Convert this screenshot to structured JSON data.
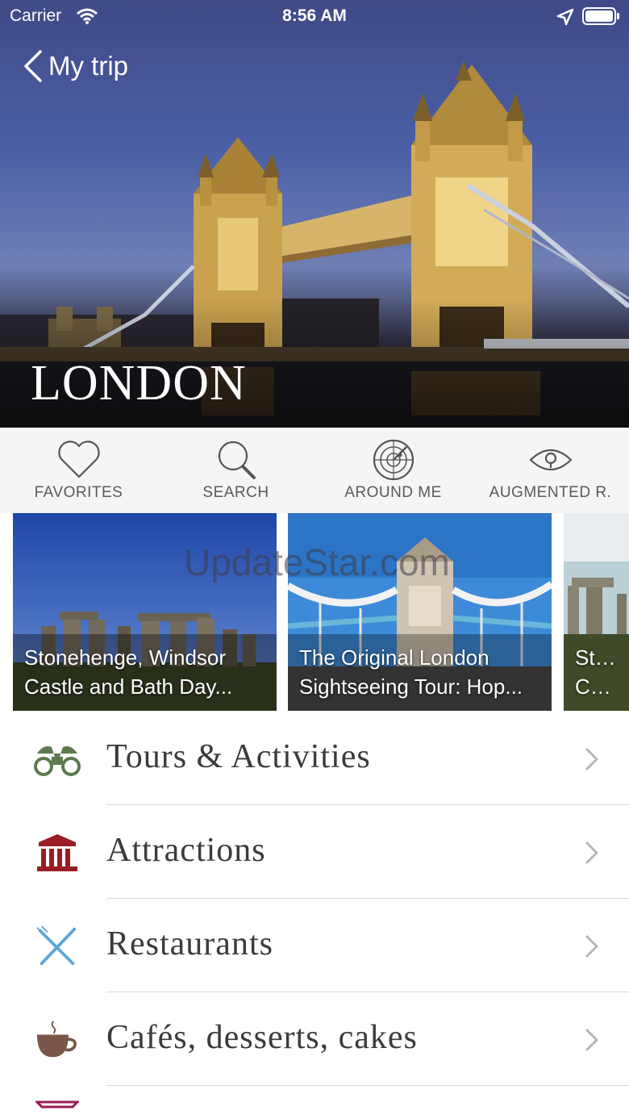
{
  "status_bar": {
    "carrier": "Carrier",
    "time": "8:56 AM"
  },
  "nav": {
    "back_label": "My trip"
  },
  "hero": {
    "title": "LONDON"
  },
  "toolbar": {
    "items": [
      {
        "label": "FAVORITES",
        "icon": "heart-icon"
      },
      {
        "label": "SEARCH",
        "icon": "search-icon"
      },
      {
        "label": "AROUND ME",
        "icon": "radar-icon"
      },
      {
        "label": "AUGMENTED R.",
        "icon": "eye-icon"
      }
    ]
  },
  "carousel": {
    "cards": [
      {
        "line1": "Stonehenge, Windsor",
        "line2": "Castle and Bath Day..."
      },
      {
        "line1": "The Original London",
        "line2": "Sightseeing Tour: Hop..."
      },
      {
        "line1": "Stone",
        "line2": "Castle"
      }
    ]
  },
  "watermark": "UpdateStar.com",
  "categories": [
    {
      "label": "Tours & Activities",
      "icon": "binoculars-icon",
      "color": "#5b7a4e"
    },
    {
      "label": "Attractions",
      "icon": "museum-icon",
      "color": "#9a1c24"
    },
    {
      "label": "Restaurants",
      "icon": "fork-knife-icon",
      "color": "#5ba4d8"
    },
    {
      "label": "Cafés, desserts, cakes",
      "icon": "coffee-cup-icon",
      "color": "#7a5548"
    }
  ]
}
